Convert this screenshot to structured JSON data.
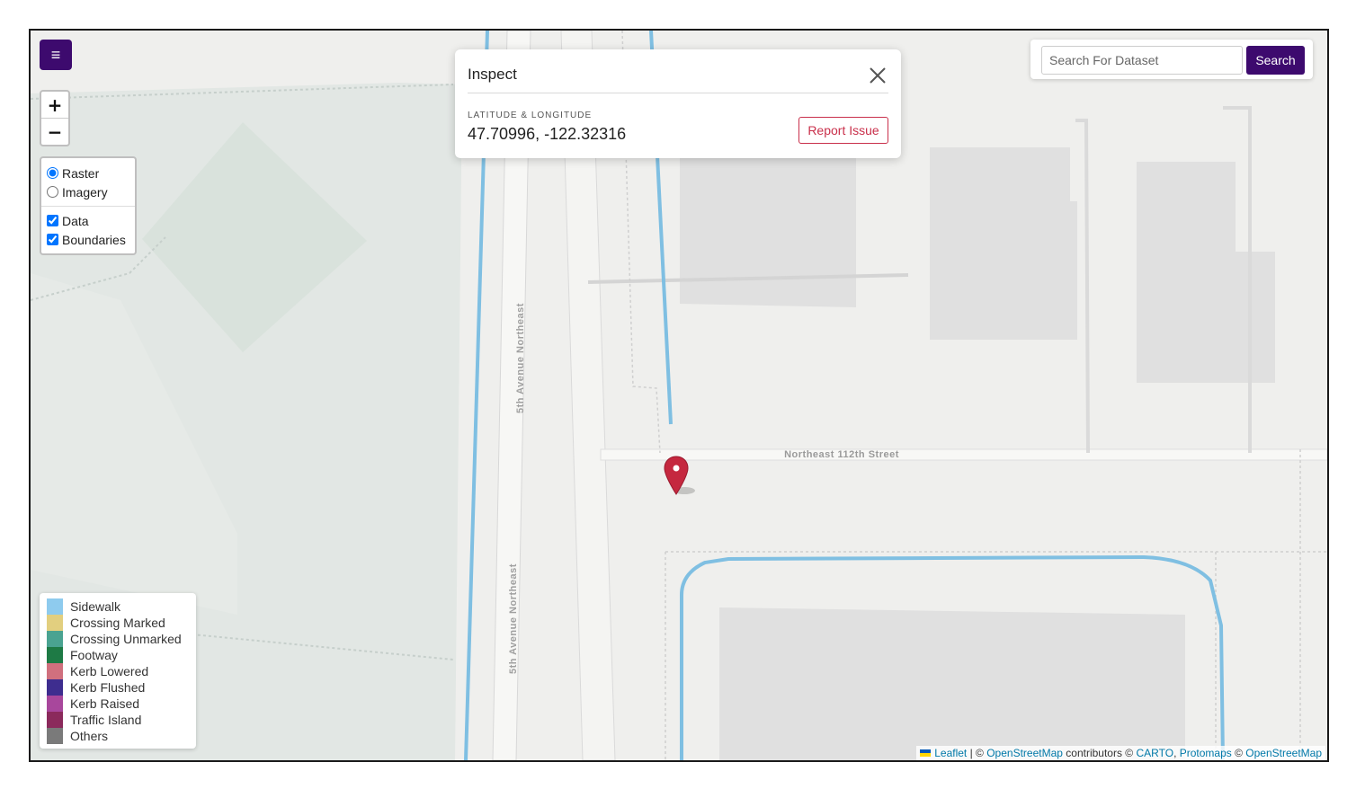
{
  "menu": {
    "icon": "hamburger-menu-icon",
    "glyph": "≡"
  },
  "zoom": {
    "in_label": "+",
    "out_label": "−"
  },
  "layers": {
    "base": [
      {
        "label": "Raster",
        "selected": true
      },
      {
        "label": "Imagery",
        "selected": false
      }
    ],
    "overlays": [
      {
        "label": "Data",
        "checked": true
      },
      {
        "label": "Boundaries",
        "checked": true
      }
    ]
  },
  "search": {
    "placeholder": "Search For Dataset",
    "value": "",
    "button_label": "Search"
  },
  "inspect": {
    "title": "Inspect",
    "coord_label": "LATITUDE & LONGITUDE",
    "coordinates": "47.70996, -122.32316",
    "report_label": "Report Issue",
    "close_icon": "close-icon"
  },
  "map": {
    "street_labels": {
      "ne_112th": "Northeast 112th Street",
      "fifth_ave_upper": "5th Avenue Northeast",
      "fifth_ave_lower": "5th Avenue Northeast"
    },
    "marker_icon": "map-pin-icon",
    "sidewalk_color": "#7fbfe2"
  },
  "legend": {
    "items": [
      {
        "label": "Sidewalk",
        "color": "#8ecbee"
      },
      {
        "label": "Crossing Marked",
        "color": "#e2cf7f"
      },
      {
        "label": "Crossing Unmarked",
        "color": "#4aa391"
      },
      {
        "label": "Footway",
        "color": "#1e7a45"
      },
      {
        "label": "Kerb Lowered",
        "color": "#d0707e"
      },
      {
        "label": "Kerb Flushed",
        "color": "#3e2d8f"
      },
      {
        "label": "Kerb Raised",
        "color": "#a8479c"
      },
      {
        "label": "Traffic Island",
        "color": "#8b2a5c"
      },
      {
        "label": "Others",
        "color": "#7a7a7a"
      }
    ]
  },
  "attribution": {
    "leaflet": "Leaflet",
    "sep1": " | © ",
    "osm1": "OpenStreetMap",
    "contributors": " contributors © ",
    "carto": "CARTO",
    "comma": ", ",
    "protomaps": "Protomaps",
    "sep2": " © ",
    "osm2": "OpenStreetMap"
  }
}
